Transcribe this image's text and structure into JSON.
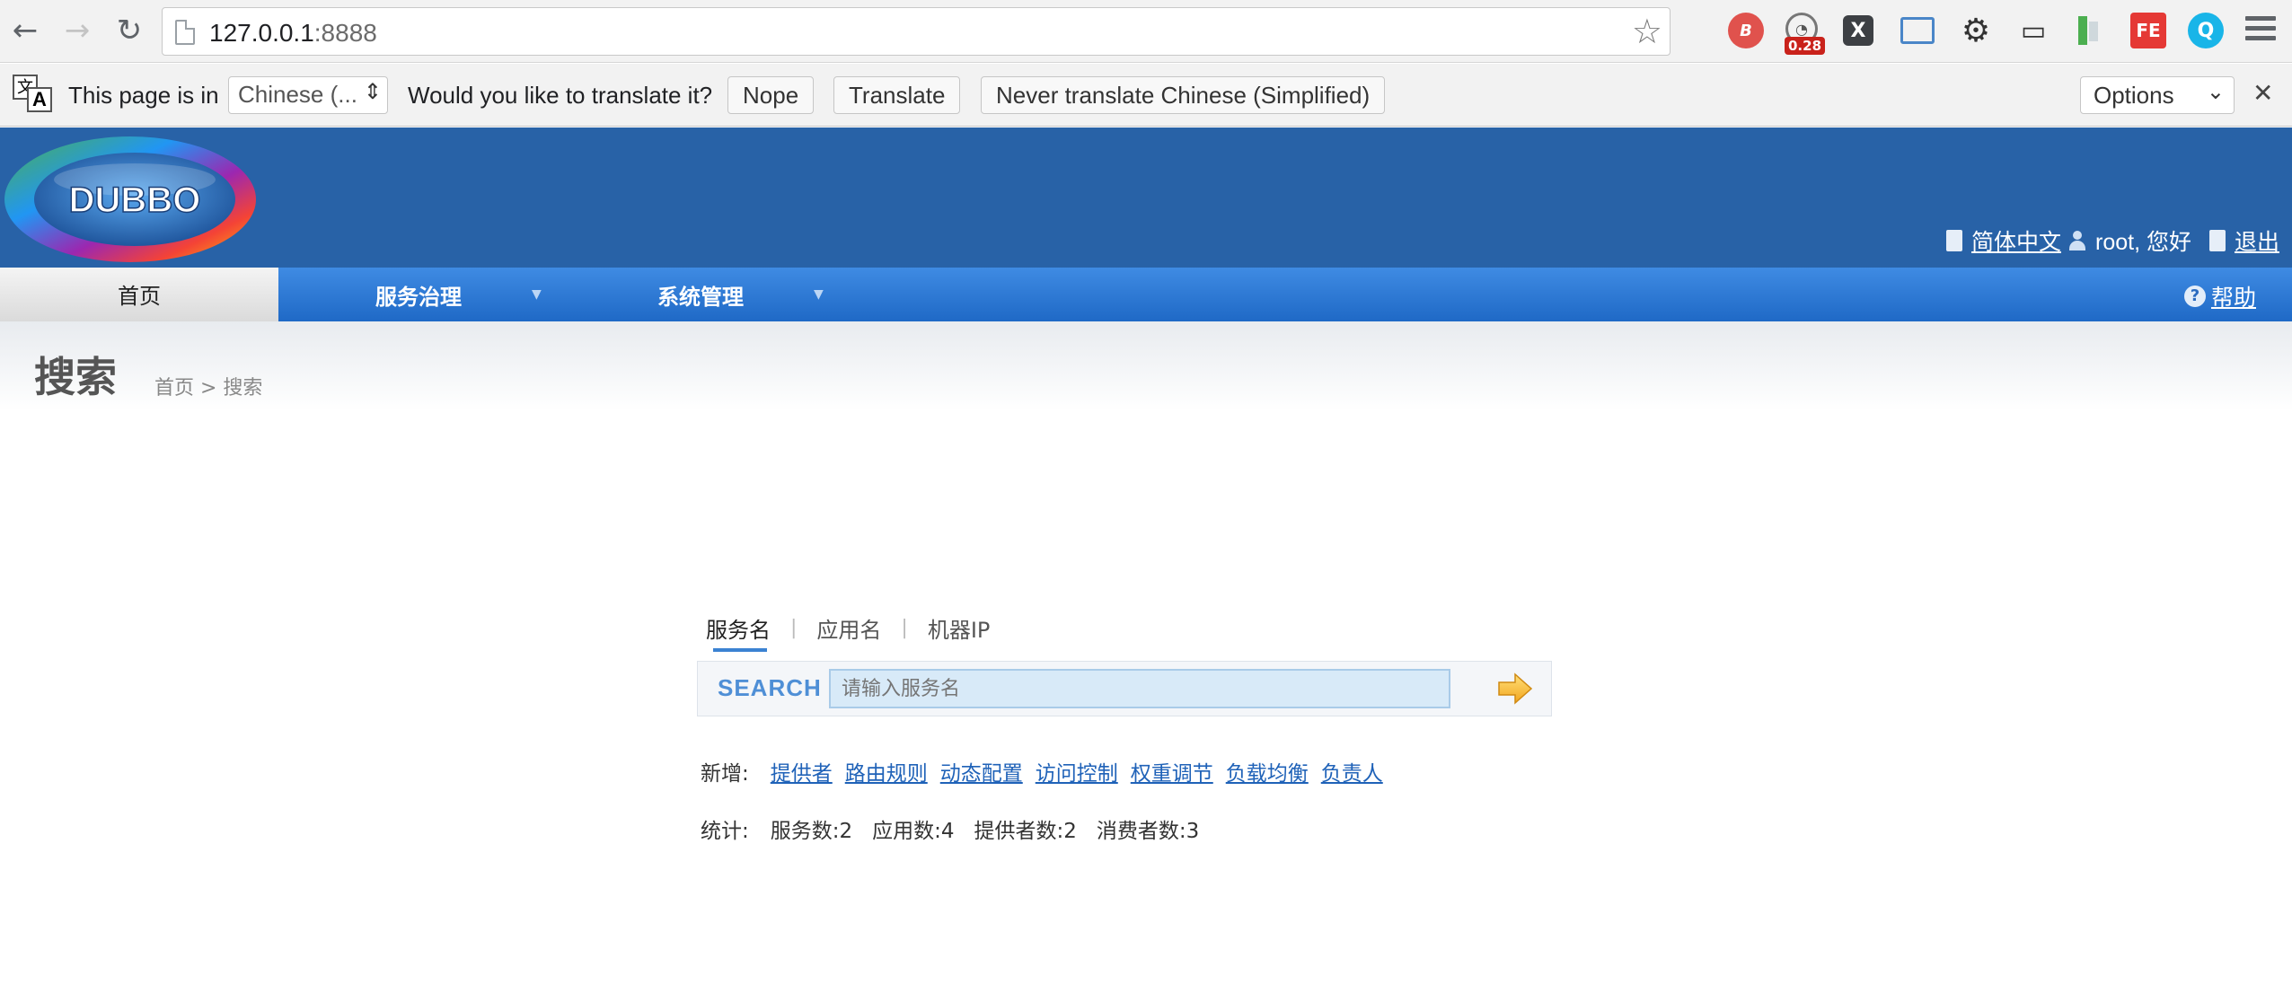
{
  "browser": {
    "url_host": "127.0.0.1",
    "url_port": ":8888",
    "extension_badge": "0.28",
    "ext_labels": {
      "e1": "B",
      "e3": "X",
      "e8": "FE",
      "e9": "Q"
    }
  },
  "translate_bar": {
    "prefix": "This page is in",
    "language": "Chinese (...",
    "question": "Would you like to translate it?",
    "nope": "Nope",
    "translate": "Translate",
    "never": "Never translate Chinese (Simplified)",
    "options": "Options"
  },
  "header": {
    "logo_text": "DUBBO",
    "lang_link": "简体中文",
    "greeting": "root, 您好",
    "logout": "退出"
  },
  "nav": {
    "home": "首页",
    "items": [
      "服务治理",
      "系统管理"
    ],
    "help": "帮助"
  },
  "content": {
    "title": "搜索",
    "breadcrumb": "首页 > 搜索"
  },
  "search": {
    "tabs": [
      "服务名",
      "应用名",
      "机器IP"
    ],
    "label": "SEARCH",
    "placeholder": "请输入服务名"
  },
  "quick_add": {
    "label": "新增:",
    "links": [
      "提供者",
      "路由规则",
      "动态配置",
      "访问控制",
      "权重调节",
      "负载均衡",
      "负责人"
    ]
  },
  "stats": {
    "label": "统计:",
    "items": [
      "服务数:2",
      "应用数:4",
      "提供者数:2",
      "消费者数:3"
    ]
  },
  "colors": {
    "header_blue": "#2862a7",
    "nav_blue": "#2f7bd6",
    "link_blue": "#1f62b8"
  }
}
